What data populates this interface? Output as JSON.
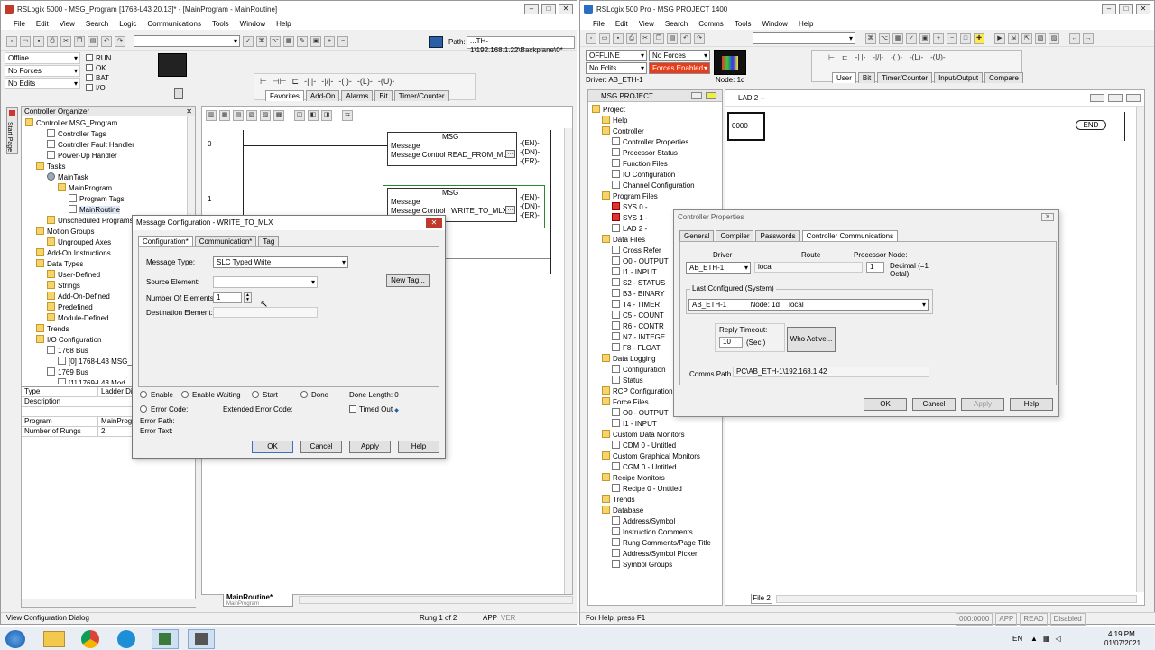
{
  "left_window": {
    "title": "RSLogix 5000 - MSG_Program [1768-L43 20.13]* - [MainProgram - MainRoutine]",
    "menu": [
      "File",
      "Edit",
      "View",
      "Search",
      "Logic",
      "Communications",
      "Tools",
      "Window",
      "Help"
    ],
    "path_label": "Path:",
    "path_value": "...TH-1\\192.168.1.22\\Backplane\\0*",
    "status_mode": "Offline",
    "status_forces": "No Forces",
    "status_edits": "No Edits",
    "indicators": [
      "RUN",
      "OK",
      "BAT",
      "I/O"
    ],
    "instr_tabs": [
      "Favorites",
      "Add-On",
      "Alarms",
      "Bit",
      "Timer/Counter"
    ],
    "organizer_title": "Controller Organizer",
    "side_tab": "Start Page",
    "tree": [
      "Controller MSG_Program",
      "Controller Tags",
      "Controller Fault Handler",
      "Power-Up Handler",
      "Tasks",
      "MainTask",
      "MainProgram",
      "Program Tags",
      "MainRoutine",
      "Unscheduled Programs",
      "Motion Groups",
      "Ungrouped Axes",
      "Add-On Instructions",
      "Data Types",
      "User-Defined",
      "Strings",
      "Add-On-Defined",
      "Predefined",
      "Module-Defined",
      "Trends",
      "I/O Configuration",
      "1768 Bus",
      "[0] 1768-L43 MSG_P",
      "1769 Bus",
      "[1] 1769-L43 Mod..."
    ],
    "props": [
      {
        "k": "Type",
        "v": "Ladder Diag"
      },
      {
        "k": "Description",
        "v": ""
      },
      {
        "k": "",
        "v": ""
      },
      {
        "k": "Program",
        "v": "MainProgra"
      },
      {
        "k": "Number of Rungs",
        "v": "2"
      }
    ],
    "rungs": [
      {
        "num": "0",
        "title": "MSG",
        "l1": "Message",
        "l2": "Message Control",
        "tag": "READ_FROM_MLX"
      },
      {
        "num": "1",
        "title": "MSG",
        "l1": "Message",
        "l2": "Message Control",
        "tag": "WRITE_TO_MLX"
      }
    ],
    "coils": [
      "EN",
      "DN",
      "ER"
    ],
    "routine_tab": "MainRoutine*",
    "routine_tab_sub": "MainProgram",
    "status_left": "View Configuration Dialog",
    "status_rung": "Rung 1 of 2",
    "status_app": "APP",
    "status_ver": "VER"
  },
  "msg_dialog": {
    "title": "Message Configuration - WRITE_TO_MLX",
    "tabs": [
      "Configuration*",
      "Communication*",
      "Tag"
    ],
    "message_type_label": "Message Type:",
    "message_type_value": "SLC Typed Write",
    "source_label": "Source Element:",
    "source_value": "",
    "count_label": "Number Of Elements:",
    "count_value": "1",
    "dest_label": "Destination Element:",
    "dest_value": "",
    "new_tag": "New Tag...",
    "status_radios": [
      "Enable",
      "Enable Waiting",
      "Start",
      "Done"
    ],
    "done_length_label": "Done Length:",
    "done_length_value": "0",
    "error_code_label": "Error Code:",
    "ext_error_label": "Extended Error Code:",
    "timed_out_label": "Timed Out",
    "timed_out_arrow": "◆",
    "error_path_label": "Error Path:",
    "error_text_label": "Error Text:",
    "buttons": [
      "OK",
      "Cancel",
      "Apply",
      "Help"
    ]
  },
  "right_window": {
    "title": "RSLogix 500 Pro - MSG PROJECT 1400",
    "menu": [
      "File",
      "Edit",
      "View",
      "Search",
      "Comms",
      "Tools",
      "Window",
      "Help"
    ],
    "mode": "OFFLINE",
    "forces": "No Forces",
    "edits": "No Edits",
    "forces_enabled": "Forces Enabled",
    "driver": "Driver: AB_ETH-1",
    "node": "Node: 1d",
    "instr_tabs": [
      "User",
      "Bit",
      "Timer/Counter",
      "Input/Output",
      "Compare"
    ],
    "project_window_title": "MSG PROJECT ...",
    "lad_window_title": "LAD 2 --",
    "rung_number": "0000",
    "end_label": "END",
    "file_tab": "File 2",
    "tree": [
      "Project",
      "Help",
      "Controller",
      "Controller Properties",
      "Processor Status",
      "Function Files",
      "IO Configuration",
      "Channel Configuration",
      "Program Files",
      "SYS 0 -",
      "SYS 1 -",
      "LAD 2 -",
      "Data Files",
      "Cross Refer",
      "O0 - OUTPUT",
      "I1 - INPUT",
      "S2 - STATUS",
      "B3 - BINARY",
      "T4 - TIMER",
      "C5 - COUNT",
      "R6 - CONTR",
      "N7 - INTEGE",
      "F8 - FLOAT",
      "Data Logging",
      "Configuration",
      "Status",
      "RCP Configuration",
      "Force Files",
      "O0 - OUTPUT",
      "I1 - INPUT",
      "Custom Data Monitors",
      "CDM 0 - Untitled",
      "Custom Graphical Monitors",
      "CGM 0 - Untitled",
      "Recipe Monitors",
      "Recipe 0 - Untitled",
      "Trends",
      "Database",
      "Address/Symbol",
      "Instruction Comments",
      "Rung Comments/Page Title",
      "Address/Symbol Picker",
      "Symbol Groups"
    ],
    "status_help": "For Help, press F1",
    "status_right": [
      "000:0000",
      "APP",
      "READ",
      "Disabled"
    ]
  },
  "ctrl_dialog": {
    "title": "Controller Properties",
    "tabs": [
      "General",
      "Compiler",
      "Passwords",
      "Controller Communications"
    ],
    "driver_label": "Driver",
    "route_label": "Route",
    "proc_node_label": "Processor Node:",
    "driver_value": "AB_ETH-1",
    "route_value": "local",
    "node_value": "1",
    "decimal_note": "Decimal (=1 Octal)",
    "last_configured_label": "Last Configured (System)",
    "last_driver": "AB_ETH-1",
    "last_node": "Node: 1d",
    "last_route": "local",
    "reply_timeout_label": "Reply Timeout:",
    "reply_timeout_value": "10",
    "sec_label": "(Sec.)",
    "who_active": "Who Active...",
    "comms_path_label": "Comms Path",
    "comms_path_value": "PC\\AB_ETH-1\\192.168.1.42",
    "buttons": [
      "OK",
      "Cancel",
      "Apply",
      "Help"
    ]
  },
  "taskbar": {
    "lang": "EN",
    "time": "4:19 PM",
    "date": "01/07/2021"
  }
}
